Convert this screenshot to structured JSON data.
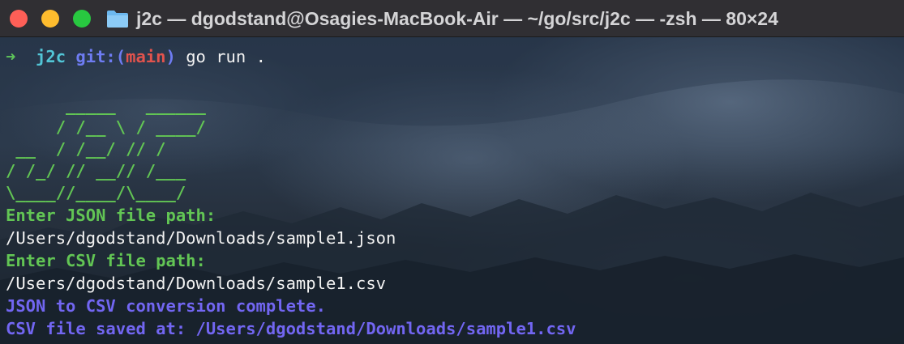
{
  "window": {
    "title": "j2c — dgodstand@Osagies-MacBook-Air — ~/go/src/j2c — -zsh — 80×24",
    "title_icon": "folder-icon",
    "traffic_lights": {
      "close_color": "#fe5f57",
      "minimize_color": "#febc2e",
      "zoom_color": "#28c840"
    }
  },
  "prompt": {
    "arrow": "➜",
    "directory": "j2c",
    "git_prefix": "git:(",
    "branch": "main",
    "git_suffix": ")",
    "command": "go run ."
  },
  "banner": [
    "      _____   ______",
    "     / /__ \\ / ____/",
    " __  / /__/ // /",
    "/ /_/ // __// /___",
    "\\____//____/\\____/"
  ],
  "output": {
    "json_prompt": "Enter JSON file path:",
    "json_path": "/Users/dgodstand/Downloads/sample1.json",
    "csv_prompt": "Enter CSV file path:",
    "csv_path": "/Users/dgodstand/Downloads/sample1.csv",
    "conversion_message": "JSON to CSV conversion complete.",
    "saved_message": "CSV file saved at: /Users/dgodstand/Downloads/sample1.csv"
  },
  "colors": {
    "prompt_arrow": "#5fc65a",
    "prompt_dir": "#52c5d6",
    "git_label": "#6e7cf2",
    "branch": "#e2534d",
    "banner_green": "#62c554",
    "success_purple": "#7266f2",
    "text": "#f2f2f2",
    "titlebar": "#302f33"
  }
}
